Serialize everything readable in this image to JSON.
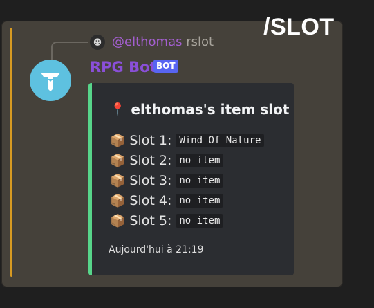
{
  "overlay": {
    "title": "/SLOT"
  },
  "reply": {
    "user": "@elthomas",
    "command": "rslot"
  },
  "message": {
    "author": "RPG Bot",
    "badge": "BOT"
  },
  "embed": {
    "title": "elthomas's item slot",
    "slots": [
      {
        "label": "Slot 1:",
        "value": "Wind Of Nature"
      },
      {
        "label": "Slot 2:",
        "value": "no item"
      },
      {
        "label": "Slot 3:",
        "value": "no item"
      },
      {
        "label": "Slot 4:",
        "value": "no item"
      },
      {
        "label": "Slot 5:",
        "value": "no item"
      }
    ],
    "footer": "Aujourd'hui à 21:19"
  },
  "icons": {
    "title_icon": "pin-icon",
    "slot_icon": "box-icon",
    "avatar_icon": "robot-avatar-icon"
  },
  "colors": {
    "embed_border": "#57d58a",
    "bot_name": "#8a4fd8",
    "badge": "#5865f2",
    "accent": "#d79a22"
  }
}
